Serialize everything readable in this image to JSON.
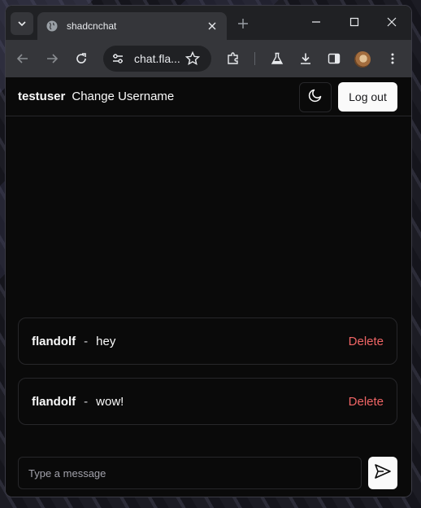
{
  "browser": {
    "tab_title": "shadcnchat",
    "url": "chat.fla...",
    "icons": [
      "tab-search-icon",
      "globe-icon",
      "close-icon",
      "plus-icon",
      "minimize-icon",
      "maximize-icon",
      "window-close-icon",
      "back-icon",
      "forward-icon",
      "reload-icon",
      "site-settings-icon",
      "star-icon",
      "extensions-icon",
      "labs-icon",
      "download-icon",
      "side-panel-icon",
      "profile-avatar",
      "more-icon"
    ]
  },
  "header": {
    "username": "testuser",
    "change_username_label": "Change Username",
    "logout_label": "Log out"
  },
  "messages": [
    {
      "author": "flandolf",
      "separator": "-",
      "text": "hey",
      "delete_label": "Delete"
    },
    {
      "author": "flandolf",
      "separator": "-",
      "text": "wow!",
      "delete_label": "Delete"
    }
  ],
  "composer": {
    "placeholder": "Type a message",
    "value": ""
  },
  "colors": {
    "background": "#0a0a0a",
    "border": "#27272a",
    "foreground": "#fafafa",
    "destructive": "#f06565"
  }
}
